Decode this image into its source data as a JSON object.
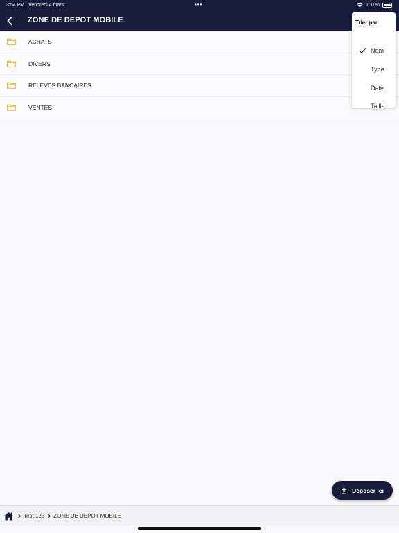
{
  "status_bar": {
    "time": "3:54 PM",
    "date": "Vendredi 4 mars",
    "battery": "100 %"
  },
  "nav": {
    "title": "ZONE DE DEPOT MOBILE"
  },
  "folders": [
    {
      "name": "ACHATS"
    },
    {
      "name": "DIVERS"
    },
    {
      "name": "RELEVES BANCAIRES"
    },
    {
      "name": "VENTES"
    }
  ],
  "sort_menu": {
    "title": "Trier par :",
    "options": [
      "Nom",
      "Type",
      "Date",
      "Taille"
    ],
    "selected": "Nom"
  },
  "upload_button": {
    "label": "Déposer ici"
  },
  "breadcrumb": {
    "items": [
      "Test 123",
      "ZONE DE DEPOT MOBILE"
    ]
  },
  "colors": {
    "header": "#181c3a",
    "folder": "#f4b63c"
  }
}
